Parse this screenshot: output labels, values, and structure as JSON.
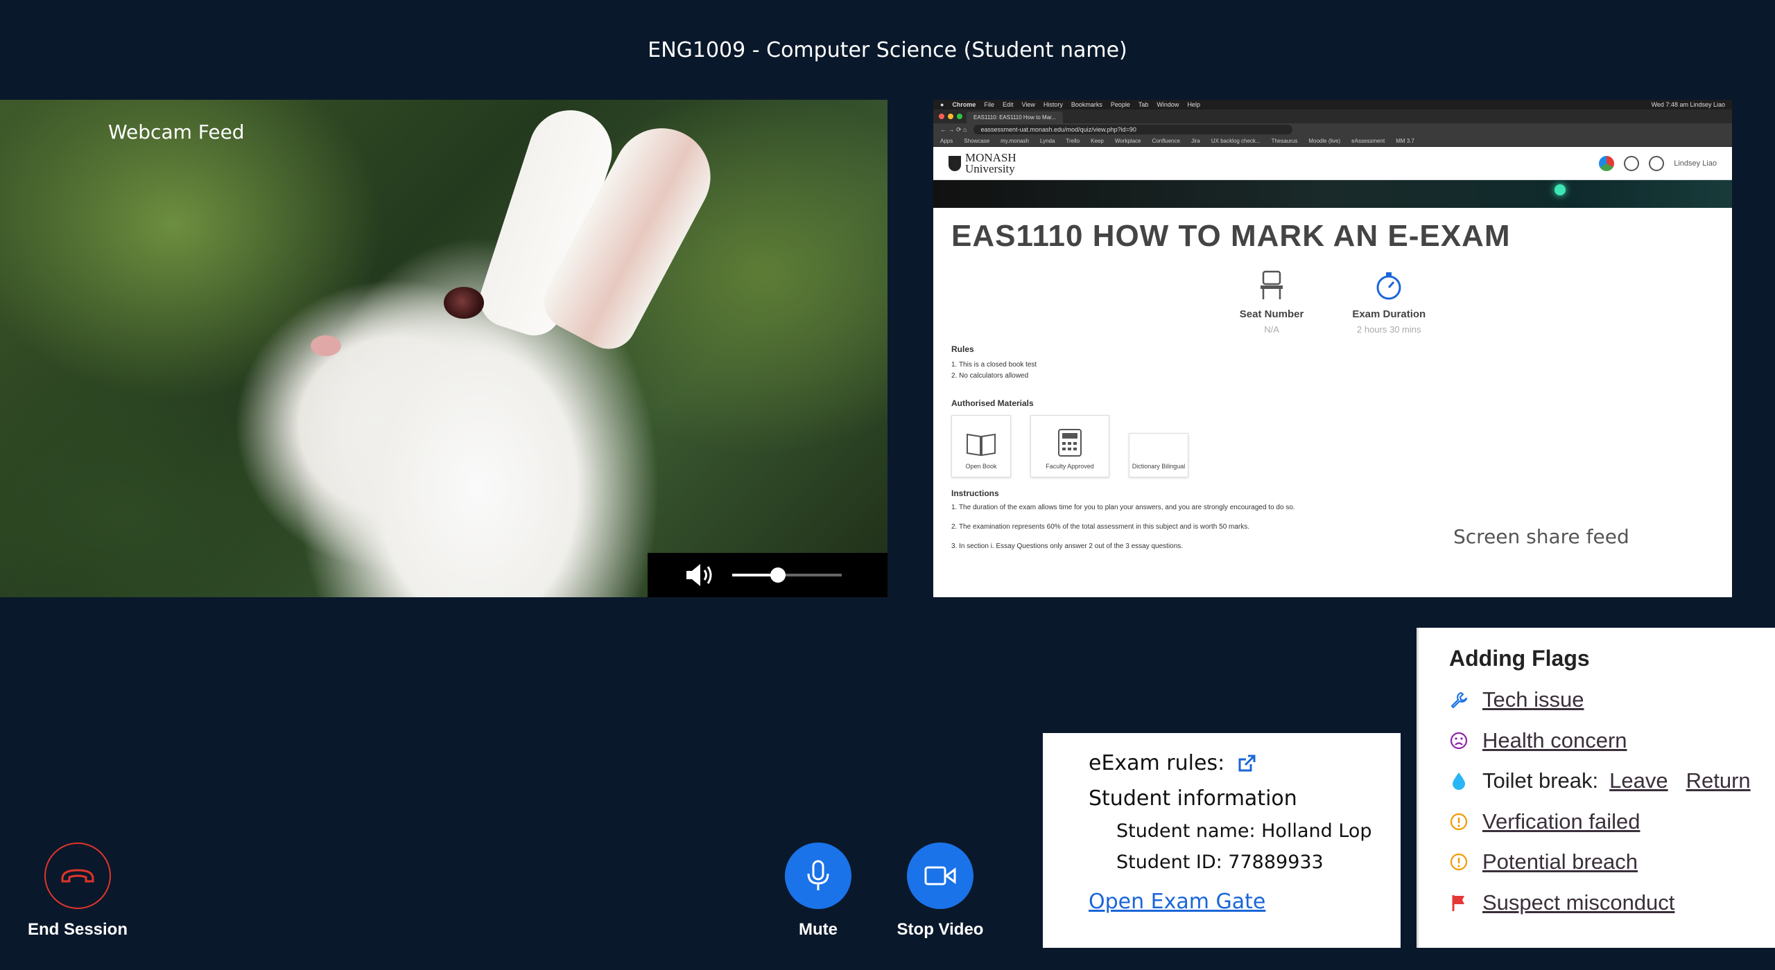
{
  "session": {
    "title": "ENG1009 - Computer Science (Student name)"
  },
  "webcam": {
    "label": "Webcam Feed",
    "volume_level": 0.42
  },
  "screen_share": {
    "label": "Screen share feed",
    "browser": {
      "menu": [
        "Chrome",
        "File",
        "Edit",
        "View",
        "History",
        "Bookmarks",
        "People",
        "Tab",
        "Window",
        "Help"
      ],
      "status_right": "Wed 7:48 am  Lindsey Liao",
      "tab_title": "EAS1110: EAS1110 How to Mar...",
      "url": "eassessment-uat.monash.edu/mod/quiz/view.php?id=90",
      "bookmarks": [
        "Apps",
        "Showcase",
        "my.monash",
        "Lynda",
        "Trello",
        "Keep",
        "Workplace",
        "Confluence",
        "Jira",
        "UX backlog check...",
        "Thesaurus",
        "Moodle (live)",
        "eAssessment",
        "MM 3.7"
      ]
    },
    "site": {
      "logo_line1": "MONASH",
      "logo_line2": "University",
      "user": "Lindsey Liao",
      "exam_title": "EAS1110 HOW TO MARK AN E-EXAM",
      "seat_label": "Seat Number",
      "seat_value": "N/A",
      "duration_label": "Exam Duration",
      "duration_value": "2 hours 30 mins",
      "rules_heading": "Rules",
      "rules": [
        "1. This is a closed book test",
        "2. No calculators allowed"
      ],
      "materials_heading": "Authorised Materials",
      "materials": [
        "Open Book",
        "Faculty Approved",
        "Dictionary Bilingual"
      ],
      "instructions_heading": "Instructions",
      "instructions": [
        "1. The duration of the exam allows time for you to plan your answers, and you are strongly encouraged to do so.",
        "2. The examination represents 60% of the total assessment in this subject and is worth 50 marks.",
        "3. In section i. Essay Questions only answer 2 out of the 3 essay questions."
      ]
    }
  },
  "controls": {
    "end": "End Session",
    "mute": "Mute",
    "video": "Stop Video"
  },
  "info": {
    "rules_label": "eExam rules:",
    "student_heading": "Student information",
    "student_name": "Student name: Holland Lop",
    "student_id": "Student ID: 77889933",
    "gate_link": "Open Exam Gate"
  },
  "flags": {
    "title": "Adding Flags",
    "tech": "Tech issue",
    "health": "Health concern",
    "toilet_label": "Toilet break:",
    "leave": "Leave",
    "return": "Return",
    "verification": "Verfication failed",
    "breach": "Potential breach",
    "misconduct": "Suspect misconduct",
    "colors": {
      "tech": "#1a73e8",
      "health": "#8e24aa",
      "toilet": "#29b6f6",
      "warn": "#f29900",
      "misconduct": "#e53935"
    }
  }
}
